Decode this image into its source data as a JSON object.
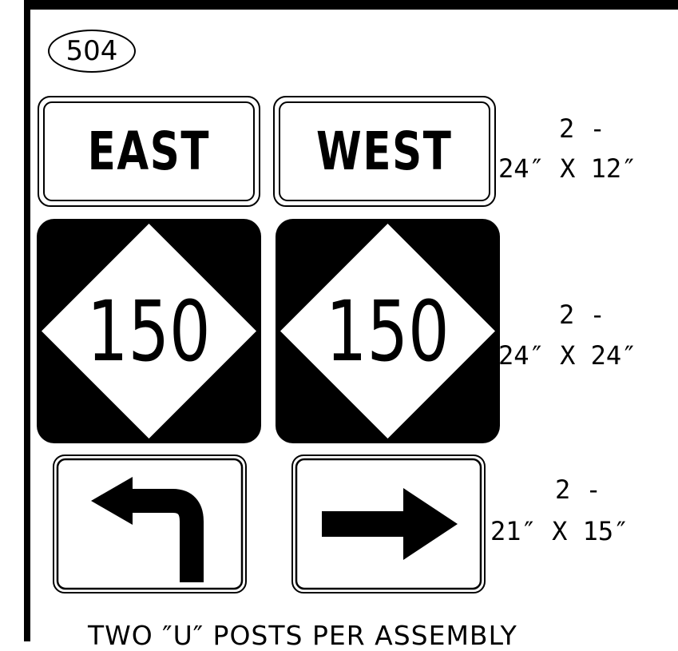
{
  "assembly_number": "504",
  "signs": {
    "east": {
      "text": "EAST"
    },
    "west": {
      "text": "WEST"
    },
    "route_left": {
      "number": "150",
      "shape": "diamond-route-marker"
    },
    "route_right": {
      "number": "150",
      "shape": "diamond-route-marker"
    },
    "arrow_left": {
      "icon": "left-turn-arrow-icon"
    },
    "arrow_right": {
      "icon": "right-arrow-icon"
    }
  },
  "sizes": [
    {
      "count": "2 -",
      "dims": "24″ X 12″"
    },
    {
      "count": "2 -",
      "dims": "24″ X 24″"
    },
    {
      "count": "2 -",
      "dims": "21″ X 15″"
    }
  ],
  "footer_note": "TWO ″U″ POSTS PER ASSEMBLY",
  "colors": {
    "ink": "#000000",
    "background": "#ffffff"
  }
}
